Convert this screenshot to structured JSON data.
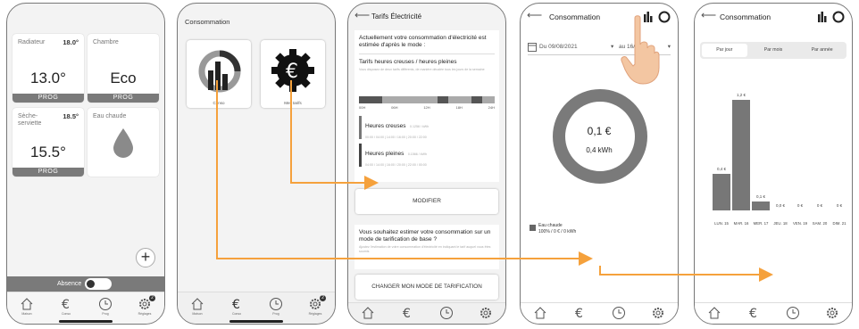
{
  "colors": {
    "arrow": "#f5a13c",
    "prog_bar": "#7a7a7a",
    "donut": "#7a7a7a",
    "bar": "#777777",
    "hand": "#f3c6a2"
  },
  "nav": {
    "home_label": "Maison",
    "conso_label": "Conso",
    "prog_label": "Prog",
    "settings_label": "Réglages",
    "settings_badge": "2",
    "icons": [
      "home-icon",
      "euro-icon",
      "clock-icon",
      "gear-icon"
    ]
  },
  "phone1": {
    "tiles": [
      {
        "label": "Radiateur",
        "temp": "18.0°",
        "value": "13.0°",
        "prog": "PROG"
      },
      {
        "label": "Chambre",
        "temp": "",
        "value": "Eco",
        "prog": "PROG"
      },
      {
        "label": "Sèche-serviette",
        "temp": "18.5°",
        "value": "15.5°",
        "prog": "PROG"
      },
      {
        "label": "Eau chaude",
        "temp": "",
        "value": "",
        "prog": ""
      }
    ],
    "absence_label": "Absence",
    "fab_label": "+"
  },
  "phone2": {
    "title": "Consommation",
    "tile1_label": "Conso",
    "tile2_label": "Mes tarifs"
  },
  "phone3": {
    "title": "Tarifs Électricité",
    "intro": "Actuellement votre consommation d'électricité est estimée d'après le mode :",
    "mode": "Tarifs heures creuses / heures pleines",
    "desc": "Vous disposez de deux tarifs différents, de manière décalée tous les jours de la semaine",
    "timeline": [
      "00H",
      "06H",
      "12H",
      "18H",
      "24H"
    ],
    "creuses_label": "Heures creuses",
    "creuses_price": "0.1256 / kWh",
    "creuses_hours": "00:00 / 04:00  |  14:00 / 16:00  |  20:00 / 22:00",
    "pleines_label": "Heures pleines",
    "pleines_price": "0.1566 / kWh",
    "pleines_hours": "04:00 / 14:00  |  16:00 / 20:00  |  22:00 / 00:00",
    "modify_button": "MODIFIER",
    "estimate_q": "Vous souhaitez estimer votre consommation sur un mode de tarification de base ?",
    "estimate_desc": "Ajustez l'estimation de votre consommation d'électricité en indiquant le tarif auquel vous êtes soumis",
    "change_button": "CHANGER MON MODE DE TARIFICATION"
  },
  "phone4": {
    "title": "Consommation",
    "date_from": "Du 09/08/2021",
    "date_to": "au 16/08",
    "donut_cost": "0,1 €",
    "donut_kwh": "0,4 kWh",
    "legend_name": "Eau chaude",
    "legend_detail": "100% / 0 € / 0 kWh"
  },
  "phone5": {
    "title": "Consommation",
    "tabs": [
      "Par jour",
      "Par mois",
      "Par année"
    ],
    "active_tab": "Par jour"
  },
  "chart_data": {
    "type": "bar",
    "categories": [
      "LUN. 15",
      "MAR. 16",
      "MER. 17",
      "JEU. 18",
      "VEN. 19",
      "SAM. 20",
      "DIM. 21"
    ],
    "day_names": [
      "LUN.",
      "MAR.",
      "MER.",
      "JEU.",
      "VEN.",
      "SAM.",
      "DIM."
    ],
    "day_numbers": [
      "15",
      "16",
      "17",
      "18",
      "19",
      "20",
      "21"
    ],
    "values": [
      0.4,
      1.2,
      0.1,
      0.0,
      0,
      0,
      0
    ],
    "value_labels": [
      "0,4 €",
      "1,2 €",
      "0,1 €",
      "0,0 €",
      "0 €",
      "0 €",
      "0 €"
    ],
    "ylim": [
      0,
      1.2
    ],
    "title": "",
    "xlabel": "",
    "ylabel": ""
  }
}
